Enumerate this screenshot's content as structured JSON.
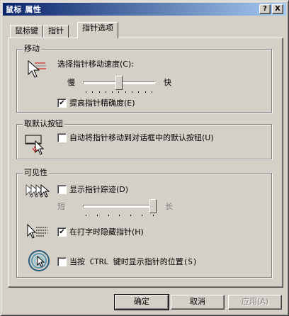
{
  "window": {
    "title": "鼠标 属性"
  },
  "titlebar": {
    "help": "?",
    "close": "X"
  },
  "tabs": [
    {
      "label": "鼠标键"
    },
    {
      "label": "指针"
    },
    {
      "label": "指针选项"
    }
  ],
  "motion": {
    "group_label": "移动",
    "speed_label": "选择指针移动速度(C):",
    "slow": "慢",
    "fast": "快",
    "speed_level": 0.5,
    "precision_label": "提高指针精确度(E)",
    "precision_checked": true
  },
  "snap": {
    "group_label": "取默认按钮",
    "checkbox_label": "自动将指针移动到对话框中的默认按钮(U)",
    "checked": false
  },
  "visibility": {
    "group_label": "可见性",
    "trails_label": "显示指针踪迹(D)",
    "trails_checked": false,
    "short": "短",
    "long": "长",
    "trail_length_level": 1.0,
    "hide_label": "在打字时隐藏指针(H)",
    "hide_checked": true,
    "ctrl_label": "当按 CTRL 键时显示指针的位置(S)",
    "ctrl_checked": false
  },
  "buttons": {
    "ok": "确定",
    "cancel": "取消",
    "apply": "应用(A)"
  },
  "check_glyph": "✔"
}
